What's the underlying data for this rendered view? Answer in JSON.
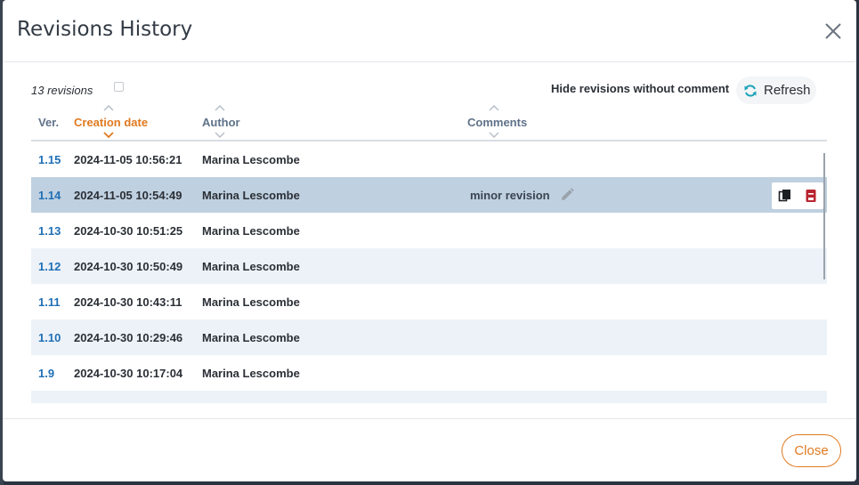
{
  "dialog": {
    "title": "Revisions History",
    "close_label": "Close"
  },
  "toolbar": {
    "revision_count": "13 revisions",
    "hide_without_comment_label": "Hide revisions without comment",
    "refresh_label": "Refresh"
  },
  "table": {
    "columns": {
      "ver": "Ver.",
      "creation_date": "Creation date",
      "author": "Author",
      "comments": "Comments"
    },
    "sorted_by": "creation_date",
    "rows": [
      {
        "ver": "1.15",
        "date": "2024-11-05 10:56:21",
        "author": "Marina Lescombe",
        "comment": ""
      },
      {
        "ver": "1.14",
        "date": "2024-11-05 10:54:49",
        "author": "Marina Lescombe",
        "comment": "minor revision"
      },
      {
        "ver": "1.13",
        "date": "2024-10-30 10:51:25",
        "author": "Marina Lescombe",
        "comment": ""
      },
      {
        "ver": "1.12",
        "date": "2024-10-30 10:50:49",
        "author": "Marina Lescombe",
        "comment": ""
      },
      {
        "ver": "1.11",
        "date": "2024-10-30 10:43:11",
        "author": "Marina Lescombe",
        "comment": ""
      },
      {
        "ver": "1.10",
        "date": "2024-10-30 10:29:46",
        "author": "Marina Lescombe",
        "comment": ""
      },
      {
        "ver": "1.9",
        "date": "2024-10-30 10:17:04",
        "author": "Marina Lescombe",
        "comment": ""
      }
    ]
  },
  "colors": {
    "accent": "#e07a21",
    "version_link": "#1f6fb5",
    "selected_row": "#bfd0e0",
    "alt_row": "#edf2f8",
    "refresh_icon": "#1aa3b8",
    "delete_icon": "#b8232f"
  },
  "icons": {
    "close": "close-icon",
    "refresh": "refresh-icon",
    "edit": "pencil-icon",
    "copy": "copy-icon",
    "delete": "delete-icon"
  }
}
